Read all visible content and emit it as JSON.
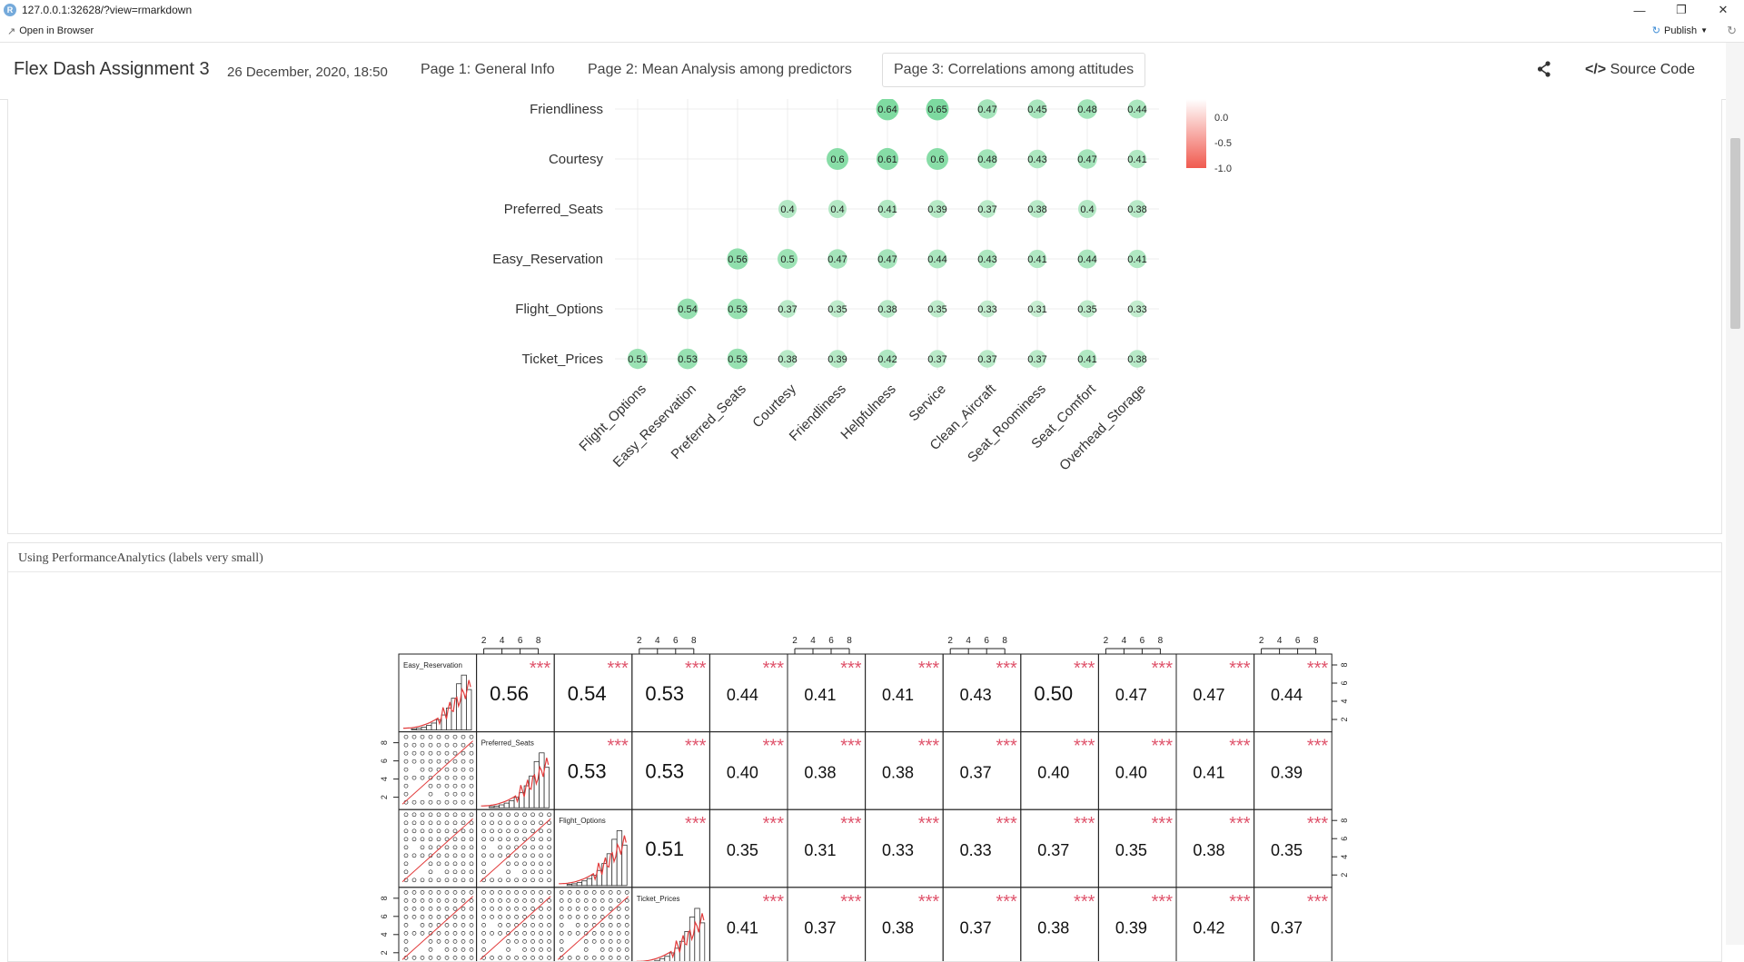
{
  "window": {
    "url": "127.0.0.1:32628/?view=rmarkdown",
    "open_in_browser": "Open in Browser",
    "publish": "Publish"
  },
  "navbar": {
    "title": "Flex Dash Assignment 3",
    "date": "26 December, 2020, 18:50",
    "tabs": [
      {
        "label": "Page 1: General Info"
      },
      {
        "label": "Page 2: Mean Analysis among predictors"
      },
      {
        "label": "Page 3: Correlations among attitudes"
      }
    ],
    "source_code": "Source Code"
  },
  "corrplot": {
    "row_labels": [
      "Friendliness",
      "Courtesy",
      "Preferred_Seats",
      "Easy_Reservation",
      "Flight_Options",
      "Ticket_Prices"
    ],
    "col_labels": [
      "Flight_Options",
      "Easy_Reservation",
      "Preferred_Seats",
      "Courtesy",
      "Friendliness",
      "Helpfulness",
      "Service",
      "Clean_Aircraft",
      "Seat_Roominess",
      "Seat_Comfort",
      "Overhead_Storage"
    ],
    "rows": [
      {
        "start": 5,
        "values": [
          "0.64",
          "0.65",
          "0.47",
          "0.45",
          "0.48",
          "0.44"
        ]
      },
      {
        "start": 4,
        "values": [
          "0.6",
          "0.61",
          "0.6",
          "0.48",
          "0.43",
          "0.47",
          "0.41"
        ]
      },
      {
        "start": 3,
        "values": [
          "0.4",
          "0.4",
          "0.41",
          "0.39",
          "0.37",
          "0.38",
          "0.4",
          "0.38"
        ]
      },
      {
        "start": 2,
        "values": [
          "0.56",
          "0.5",
          "0.47",
          "0.47",
          "0.44",
          "0.43",
          "0.41",
          "0.44",
          "0.41"
        ]
      },
      {
        "start": 1,
        "values": [
          "0.54",
          "0.53",
          "0.37",
          "0.35",
          "0.38",
          "0.35",
          "0.33",
          "0.31",
          "0.35",
          "0.33"
        ]
      },
      {
        "start": 0,
        "values": [
          "0.51",
          "0.53",
          "0.53",
          "0.38",
          "0.39",
          "0.42",
          "0.37",
          "0.37",
          "0.37",
          "0.41",
          "0.38"
        ]
      }
    ],
    "legend_labels": [
      "0.0",
      "-0.5",
      "-1.0"
    ],
    "colors": {
      "positive": "#7fd99a",
      "negative": "#f05a4f"
    }
  },
  "panel2": {
    "title": "Using PerformanceAnalytics (labels very small)"
  },
  "pairs": {
    "top_axis_ticks": [
      "2",
      "4",
      "6",
      "8"
    ],
    "side_axis_ticks": [
      "8",
      "6",
      "4",
      "2"
    ],
    "stars": "***",
    "diag_labels": [
      "Easy_Reservation",
      "Preferred_Seats",
      "Flight_Options",
      "Ticket_Prices"
    ],
    "rows": [
      [
        "0.56",
        "0.54",
        "0.53",
        "0.44",
        "0.41",
        "0.41",
        "0.43",
        "0.50",
        "0.47",
        "0.47",
        "0.44"
      ],
      [
        "0.53",
        "0.53",
        "0.40",
        "0.38",
        "0.38",
        "0.37",
        "0.40",
        "0.40",
        "0.41",
        "0.39"
      ],
      [
        "0.51",
        "0.35",
        "0.31",
        "0.33",
        "0.33",
        "0.37",
        "0.35",
        "0.38",
        "0.35"
      ],
      [
        "0.41",
        "0.37",
        "0.38",
        "0.37",
        "0.38",
        "0.39",
        "0.42",
        "0.37"
      ]
    ],
    "colors": {
      "stars": "#df536b",
      "smooth": "#e23b3b"
    }
  }
}
